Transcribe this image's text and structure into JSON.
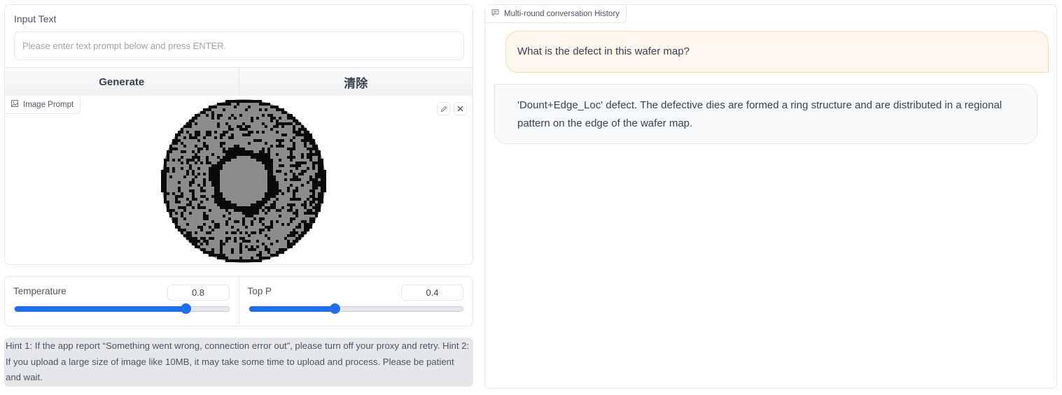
{
  "input": {
    "label": "Input Text",
    "placeholder": "Please enter text prompt below and press ENTER.",
    "value": ""
  },
  "buttons": {
    "generate": "Generate",
    "clear": "清除"
  },
  "image": {
    "label": "Image Prompt",
    "icon": "image-icon",
    "edit_icon": "pencil-icon",
    "clear_icon": "close-icon"
  },
  "params": {
    "temperature": {
      "label": "Temperature",
      "value": "0.8",
      "fraction": 0.8
    },
    "top_p": {
      "label": "Top P",
      "value": "0.4",
      "fraction": 0.4
    }
  },
  "hint": "Hint 1: If the app report “Something went wrong, connection error out”, please turn off your proxy and retry. Hint 2: If you upload a large size of image like 10MB, it may take some time to upload and process. Please be patient and wait.",
  "chat": {
    "label": "Multi-round conversation History",
    "icon": "chat-icon",
    "messages": [
      {
        "role": "user",
        "text": "What is the defect in this wafer map?"
      },
      {
        "role": "bot",
        "text": "'Dount+Edge_Loc' defect. The defective dies are formed a ring structure and are distributed in a regional pattern on the edge of the wafer map."
      }
    ]
  },
  "colors": {
    "accent": "#1b6ff0",
    "user_bubble": "#fff7ed",
    "bot_bubble": "#f9fafb",
    "wafer_fill": "#8c8c8c",
    "defect": "#0a0a0a"
  }
}
